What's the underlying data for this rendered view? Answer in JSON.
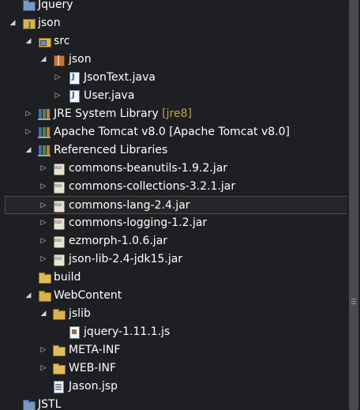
{
  "tree": {
    "items": [
      {
        "label": "Jquery",
        "icon": "project-closed-icon",
        "expanded": null
      },
      {
        "label": "json",
        "icon": "java-project-icon",
        "expanded": true
      },
      {
        "label": "src",
        "icon": "source-folder-icon",
        "expanded": true
      },
      {
        "label": "json",
        "icon": "package-icon",
        "expanded": true
      },
      {
        "label": "JsonText.java",
        "icon": "java-file-icon",
        "expanded": false
      },
      {
        "label": "User.java",
        "icon": "java-file-icon",
        "expanded": false
      },
      {
        "label": "JRE System Library",
        "decoration": "[jre8]",
        "icon": "library-icon",
        "expanded": false
      },
      {
        "label": "Apache Tomcat v8.0 [Apache Tomcat v8.0]",
        "icon": "library-icon",
        "expanded": false
      },
      {
        "label": "Referenced Libraries",
        "icon": "library-icon",
        "expanded": true
      },
      {
        "label": "commons-beanutils-1.9.2.jar",
        "icon": "jar-icon",
        "expanded": false
      },
      {
        "label": "commons-collections-3.2.1.jar",
        "icon": "jar-icon",
        "expanded": false
      },
      {
        "label": "commons-lang-2.4.jar",
        "icon": "jar-icon",
        "expanded": false,
        "selected": true
      },
      {
        "label": "commons-logging-1.2.jar",
        "icon": "jar-icon",
        "expanded": false
      },
      {
        "label": "ezmorph-1.0.6.jar",
        "icon": "jar-icon",
        "expanded": false
      },
      {
        "label": "json-lib-2.4-jdk15.jar",
        "icon": "jar-icon",
        "expanded": false
      },
      {
        "label": "build",
        "icon": "folder-icon",
        "expanded": null
      },
      {
        "label": "WebContent",
        "icon": "folder-open-icon",
        "expanded": true
      },
      {
        "label": "jslib",
        "icon": "folder-open-icon",
        "expanded": true
      },
      {
        "label": "jquery-1.11.1.js",
        "icon": "js-file-icon",
        "expanded": null
      },
      {
        "label": "META-INF",
        "icon": "folder-icon",
        "expanded": false
      },
      {
        "label": "WEB-INF",
        "icon": "folder-icon",
        "expanded": false
      },
      {
        "label": "Jason.jsp",
        "icon": "jsp-file-icon",
        "expanded": null
      },
      {
        "label": "JSTL",
        "icon": "project-closed-icon",
        "expanded": null
      }
    ]
  },
  "colors": {
    "background": "#1e1f22",
    "text": "#ffffff",
    "decoration": "#c7a14b",
    "selection_border": "#4c4d50"
  }
}
